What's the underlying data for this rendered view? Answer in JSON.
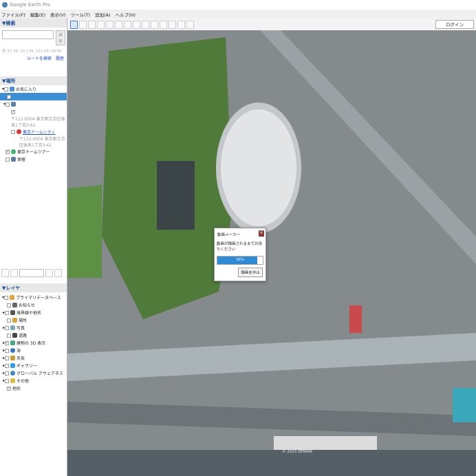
{
  "app": {
    "title": "Google Earth Pro"
  },
  "menu": [
    "ファイル(F)",
    "編集(E)",
    "表示(V)",
    "ツール(T)",
    "追加(A)",
    "ヘルプ(H)"
  ],
  "search": {
    "header": "▼検索",
    "button": "検索",
    "placeholder": "",
    "coords": "例 37 25' 19.1\"N, 122 05' 06\"W",
    "route": "ルートを検索",
    "history": "履歴"
  },
  "places": {
    "header": "▼場所",
    "items": [
      {
        "label": "お気に入り"
      },
      {
        "label": ""
      },
      {
        "label": ""
      },
      {
        "label": "〒112-0004 東京都文京区後楽1丁目3-61"
      },
      {
        "label": "東京ドームシティ"
      },
      {
        "label": "〒112-0004 東京都文京区後楽1丁目3-61"
      },
      {
        "label": "東京ドームツアー"
      },
      {
        "label": "保留"
      }
    ]
  },
  "layers": {
    "header": "▼レイヤ",
    "items": [
      {
        "label": "プライマリデータベース",
        "checked": false
      },
      {
        "label": "お知らせ",
        "checked": false
      },
      {
        "label": "境界線や地名",
        "checked": false
      },
      {
        "label": "場所",
        "checked": false
      },
      {
        "label": "写真",
        "checked": false
      },
      {
        "label": "道路",
        "checked": false
      },
      {
        "label": "建物の 3D 表示",
        "checked": true
      },
      {
        "label": "海",
        "checked": false
      },
      {
        "label": "天気",
        "checked": false
      },
      {
        "label": "ギャラリー",
        "checked": false
      },
      {
        "label": "グローバル アウェアネス",
        "checked": false
      },
      {
        "label": "その他",
        "checked": false
      },
      {
        "label": "地形",
        "checked": true
      }
    ]
  },
  "toolbar": {
    "login": "ログイン"
  },
  "dialog": {
    "title": "動画メーカー",
    "message": "動画が録画されるまでお待ちください",
    "progress_label": "36%",
    "progress_fill": 0.88,
    "stop": "録画を中止"
  },
  "map": {
    "attribution": "© 2023 ZENRIN"
  }
}
